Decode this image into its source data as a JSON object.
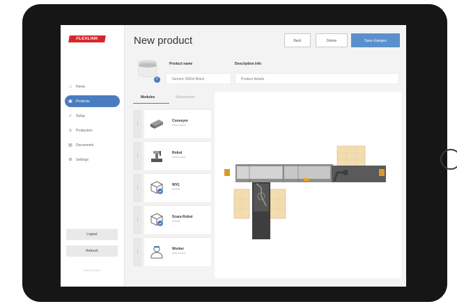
{
  "app": {
    "logo_text": "FLEXLINK"
  },
  "page": {
    "title": "New product"
  },
  "header": {
    "back_label": "Back",
    "delete_label": "Delete",
    "save_label": "Save changes"
  },
  "product": {
    "name_label": "Product name",
    "name_value": "Generic 500ml Black",
    "description_label": "Description info",
    "description_placeholder": "Product details"
  },
  "sidebar": {
    "items": [
      {
        "label": "Home",
        "icon": "home-icon",
        "active": false
      },
      {
        "label": "Products",
        "icon": "products-icon",
        "active": true
      },
      {
        "label": "Setup",
        "icon": "setup-icon",
        "active": false
      },
      {
        "label": "Production",
        "icon": "production-icon",
        "active": false
      },
      {
        "label": "Documents",
        "icon": "documents-icon",
        "active": false
      },
      {
        "label": "Settings",
        "icon": "settings-icon",
        "active": false
      }
    ],
    "logout_label": "Logout",
    "refresh_label": "Refresh",
    "footer_text": "FlexLink 2022"
  },
  "tabs": [
    {
      "label": "Modules",
      "active": true
    },
    {
      "label": "Subsystems",
      "active": false
    }
  ],
  "modules": [
    {
      "name": "Conveyor",
      "sub": "Multi-module",
      "icon": "conveyor-icon"
    },
    {
      "name": "Robot",
      "sub": "Multi-module",
      "icon": "robot-arm-icon"
    },
    {
      "name": "WX1",
      "sub": "Module",
      "icon": "cube-icon"
    },
    {
      "name": "Scara Robot",
      "sub": "Module",
      "icon": "cube-icon"
    },
    {
      "name": "Worker",
      "sub": "Staff module",
      "icon": "worker-icon"
    }
  ],
  "colors": {
    "accent": "#4a7cc0",
    "primary_button": "#5b90cc",
    "brand_red": "#d7262b",
    "pallet": "#f3ddb0",
    "conveyor": "#8e8e8e",
    "robot": "#3e3e3e"
  }
}
